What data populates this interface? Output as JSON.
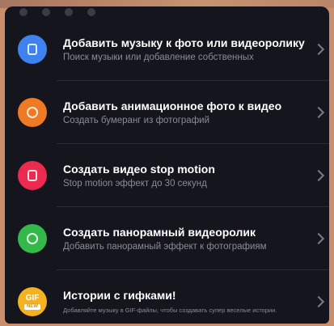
{
  "menu": {
    "items": [
      {
        "title": "Добавить музыку к фото или видеоролику",
        "subtitle": "Поиск музыки или добавление собственных",
        "icon": "music-note-icon",
        "color": "#3d82ee"
      },
      {
        "title": "Добавить анимационное фото к видео",
        "subtitle": "Создать бумеранг из фотографий",
        "icon": "boomerang-icon",
        "color": "#f07a24"
      },
      {
        "title": "Создать видео stop motion",
        "subtitle": "Stop motion эффект до 30 секунд",
        "icon": "stop-motion-icon",
        "color": "#ea2a4e"
      },
      {
        "title": "Создать панорамный видеоролик",
        "subtitle": "Добавить панорамный эффект к фотографиям",
        "icon": "panorama-icon",
        "color": "#35b84a"
      },
      {
        "title": "Истории с гифками!",
        "subtitle": "Добавляйте музыку в GIF-файлы, чтобы создавать супер веселые истории.",
        "icon": "gif-icon",
        "badge_main": "GIF",
        "badge_sub": "NEW",
        "color": "#f3b21e"
      }
    ]
  }
}
